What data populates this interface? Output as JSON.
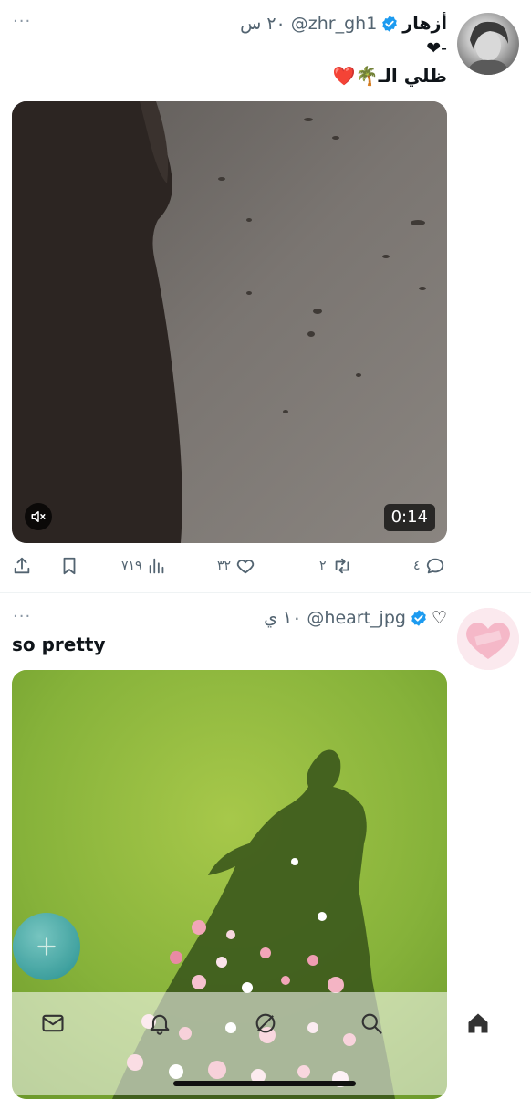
{
  "tweets": [
    {
      "display_name": "أزهار",
      "handle": "@zhr_gh1",
      "time": "٢٠ س",
      "text_line1": "-❤",
      "text_line2": "ظلي الـ🌴❤️",
      "media": {
        "type": "video",
        "duration": "0:14",
        "muted": true
      },
      "actions": {
        "replies": "٤",
        "retweets": "٢",
        "likes": "٣٢",
        "views": "٧١٩"
      }
    },
    {
      "display_name": "♡",
      "handle": "@heart_jpg",
      "time": "١٠ ي",
      "text": "so pretty",
      "media": {
        "type": "image"
      }
    }
  ],
  "more_label": "···",
  "colors": {
    "verified": "#1d9bf0",
    "muted_text": "#536471",
    "fab": "#3aa0a8"
  },
  "icons": {
    "verified": "verified-badge-icon",
    "reply": "reply-icon",
    "retweet": "retweet-icon",
    "like": "heart-icon",
    "views": "views-icon",
    "bookmark": "bookmark-icon",
    "share": "share-icon",
    "compose": "compose-icon",
    "nav": [
      "messages-icon",
      "notifications-icon",
      "grok-icon",
      "search-icon",
      "home-icon"
    ]
  }
}
